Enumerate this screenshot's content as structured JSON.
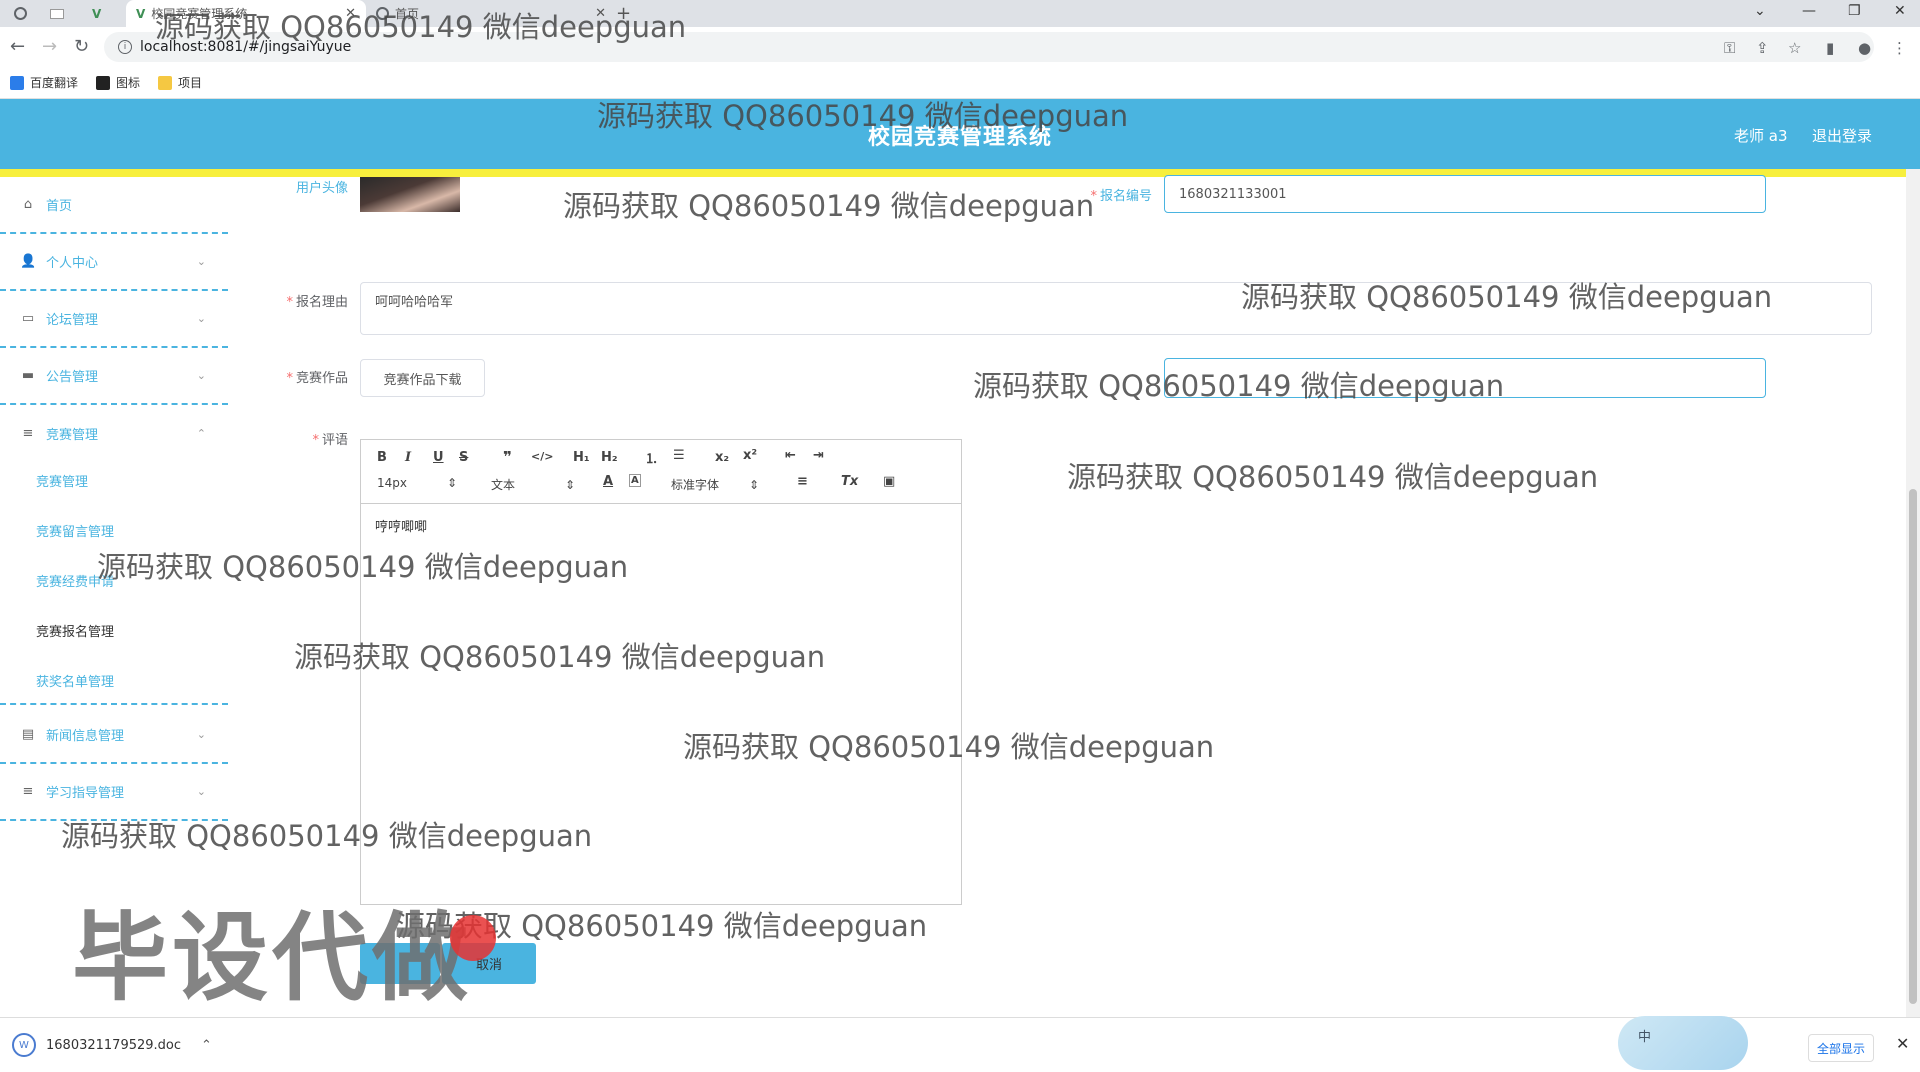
{
  "browser": {
    "tabs": [
      {
        "label": "校园竞赛管理系统"
      },
      {
        "label": "首页"
      }
    ],
    "url": "localhost:8081/#/jingsaiYuyue",
    "bookmarks": [
      "百度翻译",
      "图标",
      "项目"
    ]
  },
  "header": {
    "title": "校园竞赛管理系统",
    "user": "老师 a3",
    "logout": "退出登录"
  },
  "sidebar": {
    "items": [
      {
        "label": "首页",
        "icon": "home-icon"
      },
      {
        "label": "个人中心",
        "icon": "user-icon"
      },
      {
        "label": "论坛管理",
        "icon": "forum-icon"
      },
      {
        "label": "公告管理",
        "icon": "briefcase-icon"
      },
      {
        "label": "竞赛管理",
        "icon": "list-icon"
      },
      {
        "label": "新闻信息管理",
        "icon": "chat-icon"
      },
      {
        "label": "学习指导管理",
        "icon": "list-icon"
      }
    ],
    "subitems": [
      "竞赛管理",
      "竞赛留言管理",
      "竞赛经费申请",
      "竞赛报名管理",
      "获奖名单管理"
    ],
    "active_sub": "竞赛报名管理"
  },
  "form": {
    "avatar_label": "用户头像",
    "reg_no_label": "报名编号",
    "reg_no_value": "1680321133001",
    "reason_label": "报名理由",
    "reason_value": "呵呵哈哈哈军",
    "work_label": "竞赛作品",
    "work_button": "竞赛作品下载",
    "comment_label": "评语",
    "comment_value": "哼哼唧唧",
    "cancel": "取消"
  },
  "editor": {
    "font_size": "14px",
    "block_type": "文本",
    "font_family": "标准字体"
  },
  "download": {
    "file": "1680321179529.doc",
    "show_all": "全部显示"
  },
  "ime": "中",
  "watermarks": {
    "repeat": "源码获取 QQ86050149 微信deepguan",
    "big": "毕设代做"
  }
}
